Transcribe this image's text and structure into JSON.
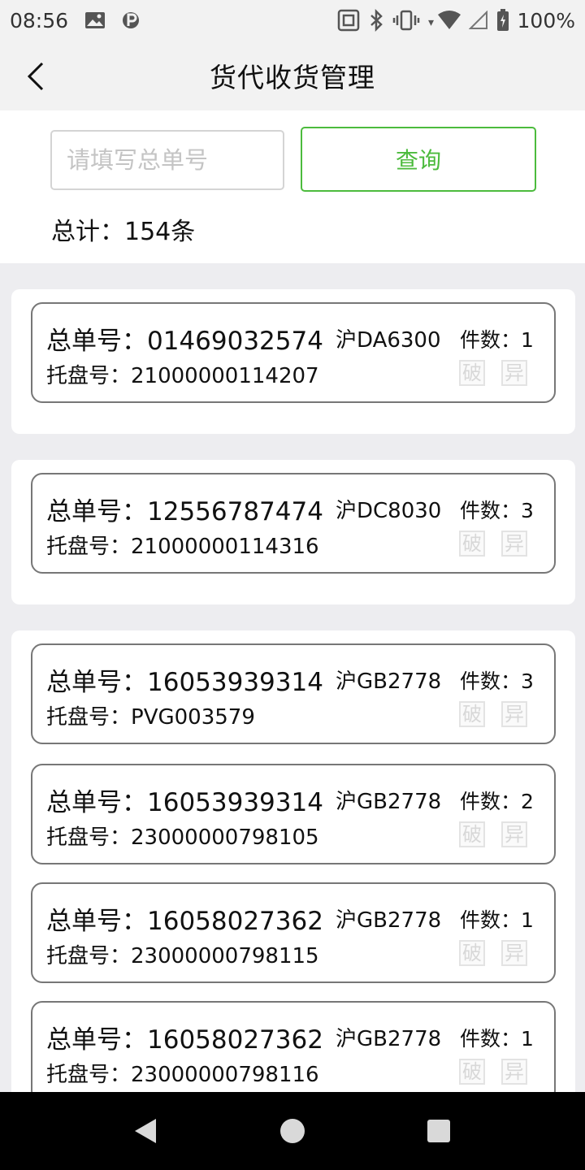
{
  "status": {
    "time": "08:56",
    "battery": "100%",
    "icons_left": [
      "image-icon",
      "parking-icon"
    ],
    "icons_right": [
      "nfc-icon",
      "bluetooth-icon",
      "vibrate-icon",
      "wifi-icon",
      "signal-icon",
      "battery-icon"
    ]
  },
  "header": {
    "title": "货代收货管理"
  },
  "search": {
    "placeholder": "请填写总单号",
    "value": "",
    "button_label": "查询"
  },
  "summary": {
    "total": "总计：154条"
  },
  "labels": {
    "main_no": "总单号：",
    "pallet": "托盘号：",
    "count": "件数：",
    "tag_break": "破",
    "tag_abnormal": "异"
  },
  "records": [
    {
      "main_no": "01469032574",
      "plate": "沪DA6300",
      "count": "1",
      "pallet": "21000000114207"
    },
    {
      "main_no": "12556787474",
      "plate": "沪DC8030",
      "count": "3",
      "pallet": "21000000114316"
    },
    {
      "main_no": "16053939314",
      "plate": "沪GB2778",
      "count": "3",
      "pallet": "PVG003579"
    },
    {
      "main_no": "16053939314",
      "plate": "沪GB2778",
      "count": "2",
      "pallet": "23000000798105"
    },
    {
      "main_no": "16058027362",
      "plate": "沪GB2778",
      "count": "1",
      "pallet": "23000000798115"
    },
    {
      "main_no": "16058027362",
      "plate": "沪GB2778",
      "count": "1",
      "pallet": "23000000798116"
    }
  ],
  "nav": {
    "icons": [
      "back-triangle-icon",
      "home-circle-icon",
      "recents-square-icon"
    ]
  },
  "colors": {
    "accent": "#4cbb3d",
    "background": "#ededf0",
    "card_border": "#777777"
  }
}
